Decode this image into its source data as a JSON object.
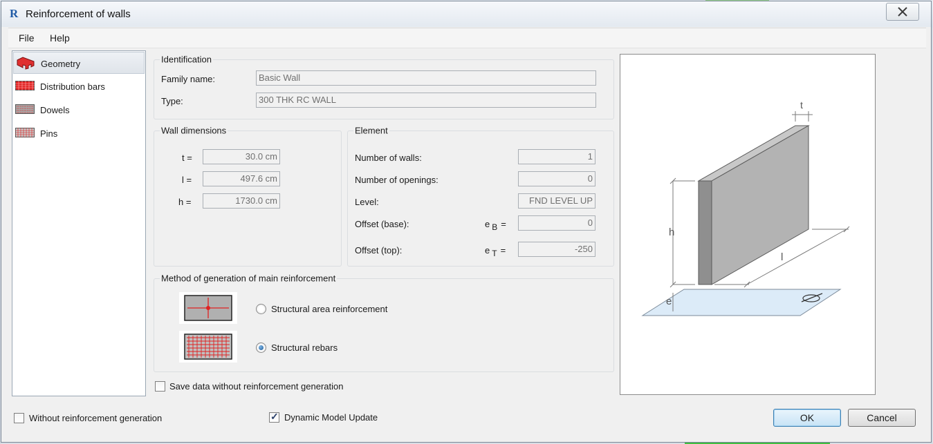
{
  "window": {
    "title": "Reinforcement of walls",
    "app_icon_letter": "R"
  },
  "menu": {
    "file": "File",
    "help": "Help"
  },
  "nav": {
    "items": [
      {
        "label": "Geometry",
        "icon": "geometry-icon",
        "selected": true
      },
      {
        "label": "Distribution bars",
        "icon": "distribution-bars-icon",
        "selected": false
      },
      {
        "label": "Dowels",
        "icon": "dowels-icon",
        "selected": false
      },
      {
        "label": "Pins",
        "icon": "pins-icon",
        "selected": false
      }
    ]
  },
  "identification": {
    "title": "Identification",
    "family_label": "Family name:",
    "family_value": "Basic Wall",
    "type_label": "Type:",
    "type_value": "300 THK RC WALL"
  },
  "wall_dimensions": {
    "title": "Wall dimensions",
    "t_label": "t =",
    "t_value": "30.0 cm",
    "l_label": "l =",
    "l_value": "497.6 cm",
    "h_label": "h =",
    "h_value": "1730.0 cm"
  },
  "element": {
    "title": "Element",
    "num_walls_label": "Number of walls:",
    "num_walls_value": "1",
    "num_openings_label": "Number of openings:",
    "num_openings_value": "0",
    "level_label": "Level:",
    "level_value": "FND LEVEL UP",
    "offset_base_label": "Offset (base):",
    "offset_base_sym": "e",
    "offset_base_sub": "B",
    "offset_base_eq": "=",
    "offset_base_value": "0",
    "offset_top_label": "Offset (top):",
    "offset_top_sym": "e",
    "offset_top_sub": "T",
    "offset_top_eq": "=",
    "offset_top_value": "-250"
  },
  "method": {
    "title": "Method of generation of main reinforcement",
    "option1_label": "Structural area reinforcement",
    "option2_label": "Structural rebars",
    "selected": "option2"
  },
  "save_data_label": "Save data without reinforcement generation",
  "save_data_checked": false,
  "without_reinf_label": "Without reinforcement generation",
  "without_reinf_checked": false,
  "dynamic_update_label": "Dynamic Model Update",
  "dynamic_update_checked": true,
  "preview": {
    "t": "t",
    "h": "h",
    "l": "l",
    "e": "e"
  },
  "buttons": {
    "ok": "OK",
    "cancel": "Cancel"
  },
  "colors": {
    "accent_red": "#e02020",
    "selection": "#dfe4ea",
    "default_button": "#c7e3f6"
  }
}
